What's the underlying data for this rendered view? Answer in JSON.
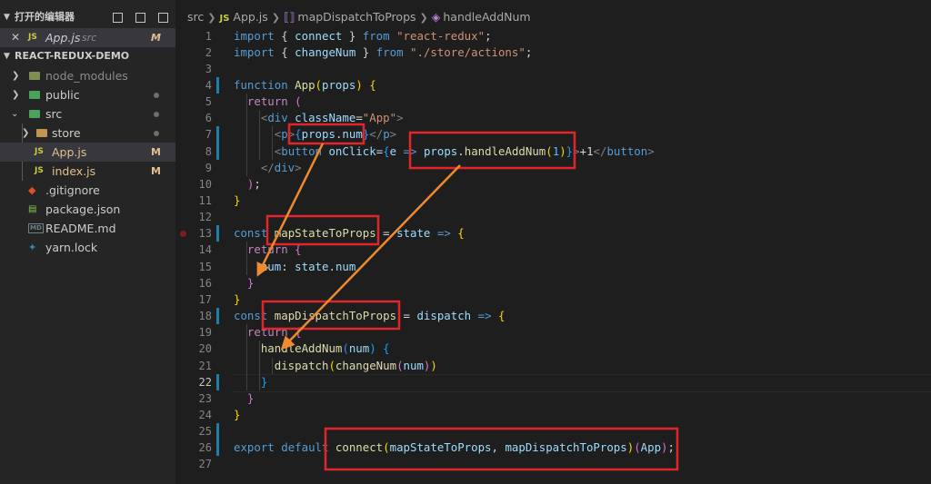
{
  "sidebar": {
    "open_editors_label": "打开的编辑器",
    "open_editor": {
      "icon": "JS",
      "name": "App.js",
      "path": "src",
      "status": "M"
    },
    "project_label": "REACT-REDUX-DEMO",
    "items": [
      {
        "name": "node_modules",
        "status": ""
      },
      {
        "name": "public",
        "status": "dot"
      },
      {
        "name": "src",
        "status": "dot"
      },
      {
        "name": "store",
        "status": "dot"
      },
      {
        "name": "App.js",
        "status": "M"
      },
      {
        "name": "index.js",
        "status": "M"
      },
      {
        "name": ".gitignore",
        "status": ""
      },
      {
        "name": "package.json",
        "status": ""
      },
      {
        "name": "README.md",
        "status": ""
      },
      {
        "name": "yarn.lock",
        "status": ""
      }
    ],
    "js_badge": "JS",
    "readme_badge": "MD",
    "status_m": "M"
  },
  "breadcrumb": {
    "folder": "src",
    "js_badge": "JS",
    "file": "App.js",
    "symbol1": "mapDispatchToProps",
    "symbol2": "handleAddNum"
  },
  "editor": {
    "current_line": 22,
    "breakpoint_line": 13,
    "line_numbers": [
      "1",
      "2",
      "3",
      "4",
      "5",
      "6",
      "7",
      "8",
      "9",
      "10",
      "11",
      "12",
      "13",
      "14",
      "15",
      "16",
      "17",
      "18",
      "19",
      "20",
      "21",
      "22",
      "23",
      "24",
      "25",
      "26",
      "27"
    ],
    "lines": [
      [
        [
          "k",
          "import"
        ],
        [
          "p",
          " { "
        ],
        [
          "v",
          "connect"
        ],
        [
          "p",
          " } "
        ],
        [
          "k",
          "from"
        ],
        [
          "p",
          " "
        ],
        [
          "s",
          "\"react-redux\""
        ],
        [
          "p",
          ";"
        ]
      ],
      [
        [
          "k",
          "import"
        ],
        [
          "p",
          " { "
        ],
        [
          "v",
          "changeNum"
        ],
        [
          "p",
          " } "
        ],
        [
          "k",
          "from"
        ],
        [
          "p",
          " "
        ],
        [
          "s",
          "\"./store/actions\""
        ],
        [
          "p",
          ";"
        ]
      ],
      [],
      [
        [
          "k",
          "function"
        ],
        [
          "p",
          " "
        ],
        [
          "f",
          "App"
        ],
        [
          "y",
          "("
        ],
        [
          "v",
          "props"
        ],
        [
          "y",
          ")"
        ],
        [
          "p",
          " "
        ],
        [
          "y",
          "{"
        ]
      ],
      [
        [
          "p",
          "  "
        ],
        [
          "kc",
          "return"
        ],
        [
          "p",
          " "
        ],
        [
          "pu",
          "("
        ]
      ],
      [
        [
          "p",
          "    "
        ],
        [
          "tg",
          "<"
        ],
        [
          "t",
          "div"
        ],
        [
          "p",
          " "
        ],
        [
          "at",
          "className"
        ],
        [
          "p",
          "="
        ],
        [
          "s",
          "\"App\""
        ],
        [
          "tg",
          ">"
        ]
      ],
      [
        [
          "p",
          "      "
        ],
        [
          "tg",
          "<"
        ],
        [
          "t",
          "p"
        ],
        [
          "tg",
          ">"
        ],
        [
          "bl",
          "{"
        ],
        [
          "v",
          "props"
        ],
        [
          "p",
          "."
        ],
        [
          "v",
          "num"
        ],
        [
          "bl",
          "}"
        ],
        [
          "tg",
          "</"
        ],
        [
          "t",
          "p"
        ],
        [
          "tg",
          ">"
        ]
      ],
      [
        [
          "p",
          "      "
        ],
        [
          "tg",
          "<"
        ],
        [
          "t",
          "button"
        ],
        [
          "p",
          " "
        ],
        [
          "at",
          "onClick"
        ],
        [
          "p",
          "="
        ],
        [
          "bl",
          "{"
        ],
        [
          "v",
          "e"
        ],
        [
          "p",
          " "
        ],
        [
          "k",
          "=>"
        ],
        [
          "p",
          " "
        ],
        [
          "v",
          "props"
        ],
        [
          "p",
          "."
        ],
        [
          "f",
          "handleAddNum"
        ],
        [
          "y",
          "("
        ],
        [
          "c",
          "1"
        ],
        [
          "y",
          ")"
        ],
        [
          "bl",
          "}"
        ],
        [
          "tg",
          ">"
        ],
        [
          "p",
          "+1"
        ],
        [
          "tg",
          "</"
        ],
        [
          "t",
          "button"
        ],
        [
          "tg",
          ">"
        ]
      ],
      [
        [
          "p",
          "    "
        ],
        [
          "tg",
          "</"
        ],
        [
          "t",
          "div"
        ],
        [
          "tg",
          ">"
        ]
      ],
      [
        [
          "p",
          "  "
        ],
        [
          "pu",
          ")"
        ],
        [
          "p",
          ";"
        ]
      ],
      [
        [
          "y",
          "}"
        ]
      ],
      [],
      [
        [
          "k",
          "const"
        ],
        [
          "p",
          " "
        ],
        [
          "f",
          "mapStateToProps"
        ],
        [
          "p",
          " = "
        ],
        [
          "v",
          "state"
        ],
        [
          "p",
          " "
        ],
        [
          "k",
          "=>"
        ],
        [
          "p",
          " "
        ],
        [
          "y",
          "{"
        ]
      ],
      [
        [
          "p",
          "  "
        ],
        [
          "kc",
          "return"
        ],
        [
          "p",
          " "
        ],
        [
          "pu",
          "{"
        ]
      ],
      [
        [
          "p",
          "    "
        ],
        [
          "v",
          "num"
        ],
        [
          "p",
          ": "
        ],
        [
          "v",
          "state"
        ],
        [
          "p",
          "."
        ],
        [
          "v",
          "num"
        ]
      ],
      [
        [
          "p",
          "  "
        ],
        [
          "pu",
          "}"
        ]
      ],
      [
        [
          "y",
          "}"
        ]
      ],
      [
        [
          "k",
          "const"
        ],
        [
          "p",
          " "
        ],
        [
          "f",
          "mapDispatchToProps"
        ],
        [
          "p",
          " = "
        ],
        [
          "v",
          "dispatch"
        ],
        [
          "p",
          " "
        ],
        [
          "k",
          "=>"
        ],
        [
          "p",
          " "
        ],
        [
          "y",
          "{"
        ]
      ],
      [
        [
          "p",
          "  "
        ],
        [
          "kc",
          "return"
        ],
        [
          "p",
          " "
        ],
        [
          "pu",
          "{"
        ]
      ],
      [
        [
          "p",
          "    "
        ],
        [
          "f",
          "handleAddNum"
        ],
        [
          "bl",
          "("
        ],
        [
          "v",
          "num"
        ],
        [
          "bl",
          ")"
        ],
        [
          "p",
          " "
        ],
        [
          "bl",
          "{"
        ]
      ],
      [
        [
          "p",
          "      "
        ],
        [
          "f",
          "dispatch"
        ],
        [
          "y",
          "("
        ],
        [
          "f",
          "changeNum"
        ],
        [
          "pu",
          "("
        ],
        [
          "v",
          "num"
        ],
        [
          "pu",
          ")"
        ],
        [
          "y",
          ")"
        ]
      ],
      [
        [
          "p",
          "    "
        ],
        [
          "bl",
          "}"
        ]
      ],
      [
        [
          "p",
          "  "
        ],
        [
          "pu",
          "}"
        ]
      ],
      [
        [
          "y",
          "}"
        ]
      ],
      [],
      [
        [
          "k",
          "export"
        ],
        [
          "p",
          " "
        ],
        [
          "k",
          "default"
        ],
        [
          "p",
          " "
        ],
        [
          "f",
          "connect"
        ],
        [
          "y",
          "("
        ],
        [
          "v",
          "mapStateToProps"
        ],
        [
          "p",
          ", "
        ],
        [
          "v",
          "mapDispatchToProps"
        ],
        [
          "y",
          ")"
        ],
        [
          "pu",
          "("
        ],
        [
          "v",
          "App"
        ],
        [
          "pu",
          ")"
        ],
        [
          "p",
          ";"
        ]
      ],
      []
    ]
  }
}
